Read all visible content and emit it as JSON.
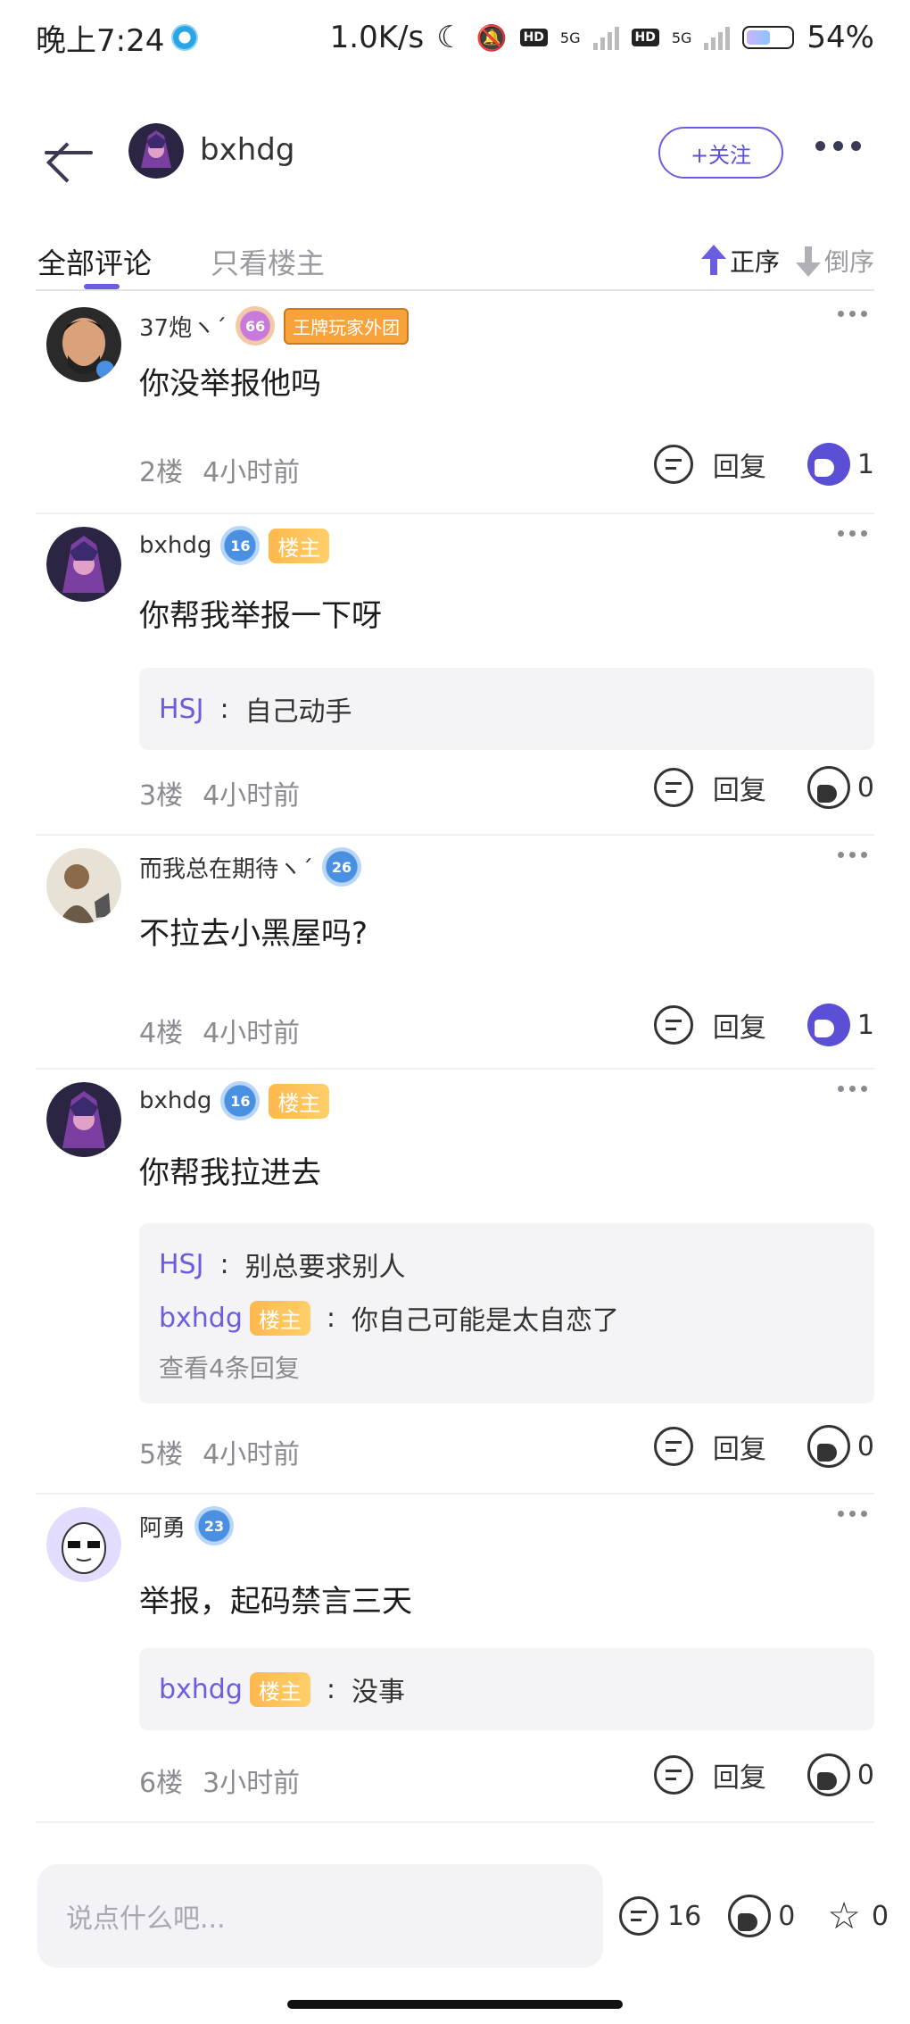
{
  "status": {
    "time": "晚上7:24",
    "speed": "1.0K/s",
    "battery": "54%",
    "net1": "5G",
    "net2": "5G",
    "hd": "HD"
  },
  "header": {
    "title": "bxhdg",
    "follow_label": "+关注"
  },
  "tabs": {
    "all": "全部评论",
    "op_only": "只看楼主",
    "asc": "正序",
    "desc": "倒序"
  },
  "comments": [
    {
      "name": "37炮ヽ´",
      "level": "66",
      "club": "王牌玩家外团",
      "text": "你没举报他吗",
      "floor": "2楼",
      "time": "4小时前",
      "reply": "回复",
      "likes": "1"
    },
    {
      "name": "bxhdg",
      "level": "16",
      "op": "楼主",
      "text": "你帮我举报一下呀",
      "floor": "3楼",
      "time": "4小时前",
      "reply": "回复",
      "likes": "0",
      "sub": [
        {
          "user": "HSJ",
          "text": "自己动手"
        }
      ]
    },
    {
      "name": "而我总在期待ヽ´",
      "level": "26",
      "text": "不拉去小黑屋吗?",
      "floor": "4楼",
      "time": "4小时前",
      "reply": "回复",
      "likes": "1"
    },
    {
      "name": "bxhdg",
      "level": "16",
      "op": "楼主",
      "text": "你帮我拉进去",
      "floor": "5楼",
      "time": "4小时前",
      "reply": "回复",
      "likes": "0",
      "sub": [
        {
          "user": "HSJ",
          "text": "别总要求别人"
        },
        {
          "user": "bxhdg",
          "op": "楼主",
          "text": "你自己可能是太自恋了"
        }
      ],
      "view_more": "查看4条回复"
    },
    {
      "name": "阿勇",
      "level": "23",
      "text": "举报，起码禁言三天",
      "floor": "6楼",
      "time": "3小时前",
      "reply": "回复",
      "likes": "0",
      "sub": [
        {
          "user": "bxhdg",
          "op": "楼主",
          "text": "没事"
        }
      ]
    }
  ],
  "bottom": {
    "placeholder": "说点什么吧...",
    "comments": "16",
    "likes": "0",
    "stars": "0"
  },
  "colors": {
    "accent": "#6b5de0",
    "op_tag": "#ffb84d"
  }
}
